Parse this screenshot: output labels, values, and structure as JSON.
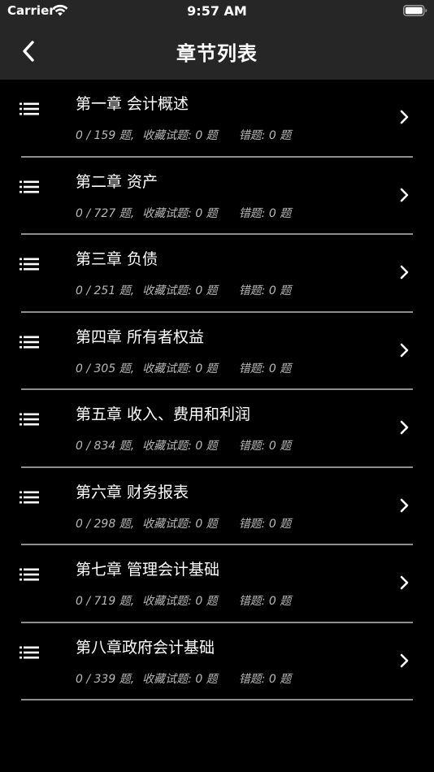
{
  "status_bar": {
    "carrier": "Carrier",
    "time": "9:57 AM"
  },
  "nav": {
    "title": "章节列表",
    "back_icon": "chevron-left-icon"
  },
  "colors": {
    "background": "#000000",
    "bar": "#262626",
    "divider": "#8e8e8e",
    "secondary_text": "#b8b8b8"
  },
  "chapters": [
    {
      "name": "第一章 会计概述",
      "progress": "0 / 159 题,",
      "favorites": "收藏试题: 0 题",
      "errors": "错题: 0 题"
    },
    {
      "name": "第二章 资产",
      "progress": "0 / 727 题,",
      "favorites": "收藏试题: 0 题",
      "errors": "错题: 0 题"
    },
    {
      "name": "第三章 负债",
      "progress": "0 / 251 题,",
      "favorites": "收藏试题: 0 题",
      "errors": "错题: 0 题"
    },
    {
      "name": "第四章 所有者权益",
      "progress": "0 / 305 题,",
      "favorites": "收藏试题: 0 题",
      "errors": "错题: 0 题"
    },
    {
      "name": "第五章 收入、费用和利润",
      "progress": "0 / 834 题,",
      "favorites": "收藏试题: 0 题",
      "errors": "错题: 0 题"
    },
    {
      "name": "第六章 财务报表",
      "progress": "0 / 298 题,",
      "favorites": "收藏试题: 0 题",
      "errors": "错题: 0 题"
    },
    {
      "name": "第七章 管理会计基础",
      "progress": "0 / 719 题,",
      "favorites": "收藏试题: 0 题",
      "errors": "错题: 0 题"
    },
    {
      "name": "第八章政府会计基础",
      "progress": "0 / 339 题,",
      "favorites": "收藏试题: 0 题",
      "errors": "错题: 0 题"
    }
  ]
}
